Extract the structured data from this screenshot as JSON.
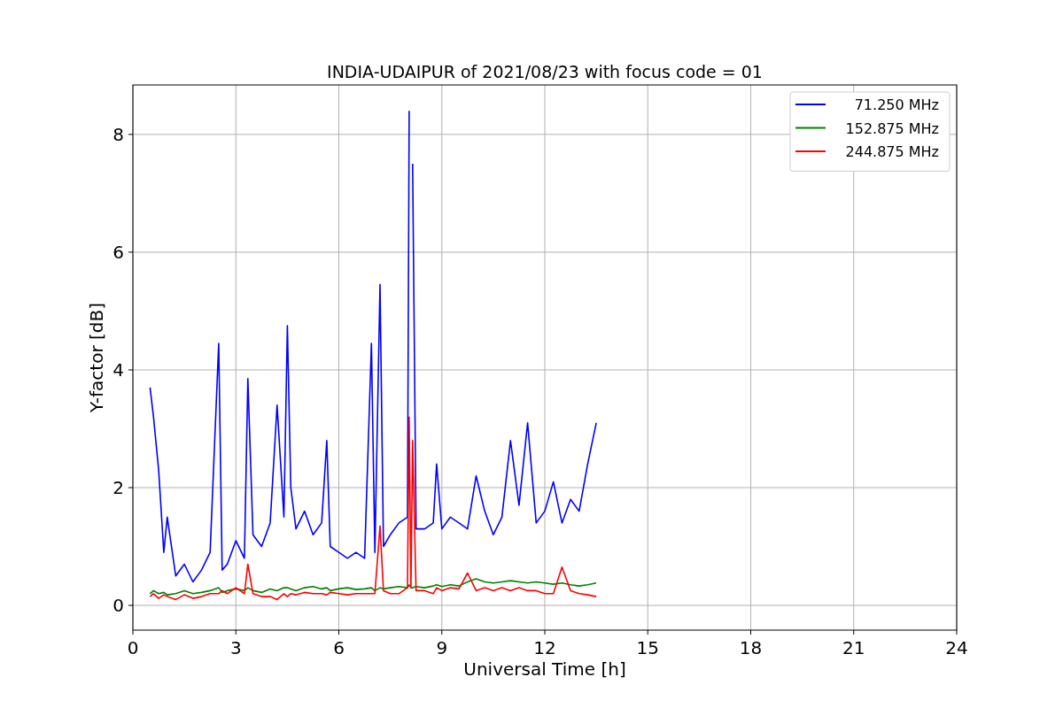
{
  "chart_data": {
    "type": "line",
    "title": "INDIA-UDAIPUR of 2021/08/23 with focus code = 01",
    "xlabel": "Universal Time [h]",
    "ylabel": "Y-factor [dB]",
    "x": [
      0.5,
      0.6,
      0.75,
      0.9,
      1.0,
      1.25,
      1.5,
      1.75,
      2.0,
      2.25,
      2.5,
      2.6,
      2.75,
      3.0,
      3.25,
      3.35,
      3.5,
      3.75,
      4.0,
      4.2,
      4.4,
      4.5,
      4.6,
      4.75,
      5.0,
      5.25,
      5.5,
      5.65,
      5.75,
      6.0,
      6.25,
      6.5,
      6.75,
      6.95,
      7.05,
      7.2,
      7.3,
      7.5,
      7.75,
      8.0,
      8.05,
      8.1,
      8.15,
      8.25,
      8.5,
      8.75,
      8.85,
      9.0,
      9.25,
      9.5,
      9.75,
      10.0,
      10.25,
      10.5,
      10.75,
      11.0,
      11.25,
      11.5,
      11.75,
      12.0,
      12.25,
      12.5,
      12.75,
      13.0,
      13.25,
      13.5
    ],
    "series": [
      {
        "name": "71.250 MHz",
        "color": "#0000ff",
        "values": [
          3.7,
          3.2,
          2.3,
          0.9,
          1.5,
          0.5,
          0.7,
          0.4,
          0.6,
          0.9,
          4.45,
          0.6,
          0.7,
          1.1,
          0.8,
          3.85,
          1.2,
          1.0,
          1.4,
          3.4,
          1.5,
          4.75,
          2.0,
          1.3,
          1.6,
          1.2,
          1.4,
          2.8,
          1.0,
          0.9,
          0.8,
          0.9,
          0.8,
          4.45,
          0.9,
          5.45,
          1.0,
          1.2,
          1.4,
          1.5,
          8.4,
          null,
          7.5,
          1.3,
          1.3,
          1.4,
          2.4,
          1.3,
          1.5,
          1.4,
          1.3,
          2.2,
          1.6,
          1.2,
          1.5,
          2.8,
          1.7,
          3.1,
          1.4,
          1.6,
          2.1,
          1.4,
          1.8,
          1.6,
          2.4,
          3.1
        ]
      },
      {
        "name": "152.875 MHz",
        "color": "#008000",
        "values": [
          0.2,
          0.25,
          0.2,
          0.22,
          0.18,
          0.2,
          0.25,
          0.2,
          0.22,
          0.25,
          0.3,
          0.22,
          0.25,
          0.28,
          0.25,
          0.3,
          0.25,
          0.22,
          0.28,
          0.25,
          0.3,
          0.3,
          0.28,
          0.25,
          0.3,
          0.32,
          0.28,
          0.3,
          0.25,
          0.28,
          0.3,
          0.27,
          0.28,
          0.3,
          0.25,
          0.3,
          0.28,
          0.3,
          0.32,
          0.3,
          0.35,
          0.3,
          0.3,
          0.32,
          0.3,
          0.33,
          0.35,
          0.32,
          0.35,
          0.33,
          0.4,
          0.45,
          0.4,
          0.38,
          0.4,
          0.42,
          0.4,
          0.38,
          0.4,
          0.38,
          0.36,
          0.38,
          0.35,
          0.33,
          0.35,
          0.38
        ]
      },
      {
        "name": "244.875 MHz",
        "color": "#ff0000",
        "values": [
          0.15,
          0.2,
          0.12,
          0.18,
          0.15,
          0.1,
          0.18,
          0.12,
          0.15,
          0.2,
          0.2,
          0.25,
          0.2,
          0.3,
          0.2,
          0.7,
          0.2,
          0.15,
          0.15,
          0.1,
          0.2,
          0.15,
          0.2,
          0.18,
          0.22,
          0.2,
          0.2,
          0.18,
          0.22,
          0.2,
          0.18,
          0.2,
          0.2,
          0.2,
          0.2,
          1.35,
          0.25,
          0.2,
          0.2,
          0.3,
          3.2,
          0.3,
          2.8,
          0.25,
          0.25,
          0.2,
          0.3,
          0.25,
          0.3,
          0.28,
          0.55,
          0.25,
          0.3,
          0.25,
          0.3,
          0.25,
          0.3,
          0.25,
          0.25,
          0.2,
          0.2,
          0.65,
          0.25,
          0.2,
          0.18,
          0.15
        ]
      }
    ],
    "xlim": [
      0,
      24
    ],
    "ylim": [
      -0.42,
      8.84
    ],
    "xticks": [
      0,
      3,
      6,
      9,
      12,
      15,
      18,
      21,
      24
    ],
    "yticks": [
      0,
      2,
      4,
      6,
      8
    ],
    "grid": true,
    "legend": true
  }
}
